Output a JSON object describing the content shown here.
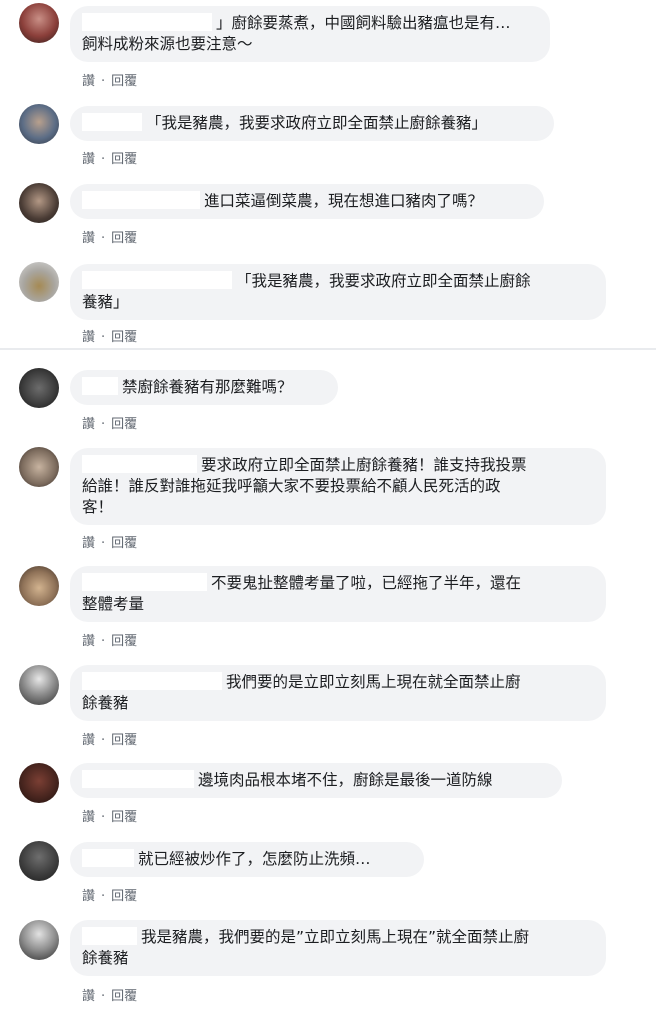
{
  "comments": [
    {
      "text": "」廚餘要蒸煮，中國飼料驗出豬瘟也是有…\n飼料成粉來源也要注意～",
      "like": "讚",
      "reply": "回覆"
    },
    {
      "text": "「我是豬農，我要求政府立即全面禁止廚餘養豬」",
      "like": "讚",
      "reply": "回覆"
    },
    {
      "text": "進口菜逼倒菜農，現在想進口豬肉了嗎？",
      "like": "讚",
      "reply": "回覆"
    },
    {
      "text": "「我是豬農，我要求政府立即全面禁止廚餘\n養豬」",
      "like": "讚",
      "reply": "回覆"
    },
    {
      "text": "禁廚餘養豬有那麼難嗎？",
      "like": "讚",
      "reply": "回覆"
    },
    {
      "text": "要求政府立即全面禁止廚餘養豬！誰支持我投票\n給誰！誰反對誰拖延我呼籲大家不要投票給不顧人民死活的政\n客！",
      "like": "讚",
      "reply": "回覆"
    },
    {
      "text": "不要鬼扯整體考量了啦，已經拖了半年，還在\n整體考量",
      "like": "讚",
      "reply": "回覆"
    },
    {
      "text": "我們要的是立即立刻馬上現在就全面禁止廚\n餘養豬",
      "like": "讚",
      "reply": "回覆"
    },
    {
      "text": "邊境肉品根本堵不住，廚餘是最後一道防線",
      "like": "讚",
      "reply": "回覆"
    },
    {
      "text": "就已經被炒作了，怎麼防止洗頻…",
      "like": "讚",
      "reply": "回覆"
    },
    {
      "text": "我是豬農，我們要的是”立即立刻馬上現在”就全面禁止廚\n餘養豬",
      "like": "讚",
      "reply": "回覆"
    }
  ]
}
